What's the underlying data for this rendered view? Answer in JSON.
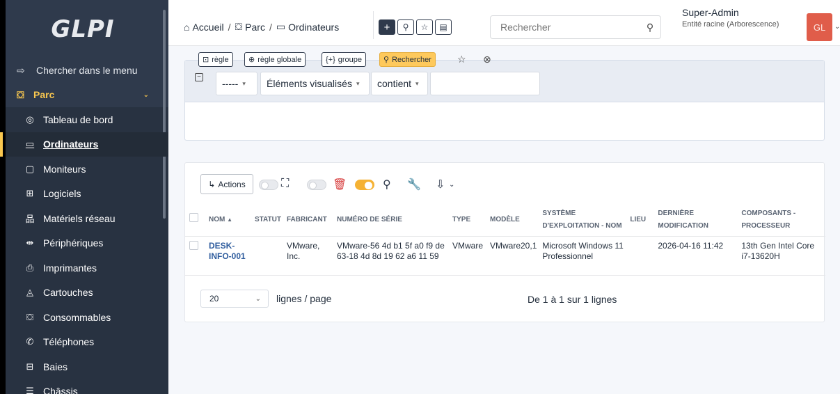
{
  "app": {
    "logo": "GLPI"
  },
  "sidebar": {
    "search_label": "Chercher dans le menu",
    "section": "Parc",
    "items": [
      {
        "label": "Tableau de bord",
        "icon": "dashboard-icon"
      },
      {
        "label": "Ordinateurs",
        "icon": "computer-icon",
        "active": true
      },
      {
        "label": "Moniteurs",
        "icon": "monitor-icon"
      },
      {
        "label": "Logiciels",
        "icon": "software-icon"
      },
      {
        "label": "Matériels réseau",
        "icon": "network-icon"
      },
      {
        "label": "Périphériques",
        "icon": "peripheral-icon"
      },
      {
        "label": "Imprimantes",
        "icon": "printer-icon"
      },
      {
        "label": "Cartouches",
        "icon": "cartridge-icon"
      },
      {
        "label": "Consommables",
        "icon": "consumable-icon"
      },
      {
        "label": "Téléphones",
        "icon": "phone-icon"
      },
      {
        "label": "Baies",
        "icon": "rack-icon"
      },
      {
        "label": "Châssis",
        "icon": "chassis-icon"
      }
    ]
  },
  "topbar": {
    "breadcrumb": [
      "Accueil",
      "Parc",
      "Ordinateurs"
    ],
    "search_placeholder": "Rechercher",
    "user_name": "Super-Admin",
    "user_entity": "Entité racine (Arborescence)",
    "avatar_initials": "GL"
  },
  "criteria": {
    "field_select": "-----",
    "items_select": "Éléments visualisés",
    "operator_select": "contient",
    "value": "",
    "rule_label": "règle",
    "global_rule_label": "règle globale",
    "group_label": "groupe",
    "search_label": "Rechercher"
  },
  "results": {
    "actions_label": "Actions",
    "columns": [
      "NOM",
      "STATUT",
      "FABRICANT",
      "NUMÉRO DE SÉRIE",
      "TYPE",
      "MODÈLE",
      "SYSTÈME D'EXPLOITATION - NOM",
      "LIEU",
      "DERNIÈRE MODIFICATION",
      "COMPOSANTS - PROCESSEUR"
    ],
    "rows": [
      {
        "nom": "DESK-INFO-001",
        "statut": "",
        "fabricant": "VMware, Inc.",
        "serie": "VMware-56 4d b1 5f a0 f9 de 63-18 4d 8d 19 62 a6 11 59",
        "type": "VMware",
        "modele": "VMware20,1",
        "os": "Microsoft Windows 11 Professionnel",
        "lieu": "",
        "modif": "2026-04-16 11:42",
        "processeur": "13th Gen Intel Core i7-13620H"
      }
    ],
    "page_size": "20",
    "page_size_label": "lignes / page",
    "pagination_info": "De 1 à 1 sur 1 lignes"
  },
  "colors": {
    "sidebar_bg": "#2f3a4c",
    "accent": "#fec95c",
    "link": "#2f5d9e",
    "avatar": "#e05d4a"
  }
}
